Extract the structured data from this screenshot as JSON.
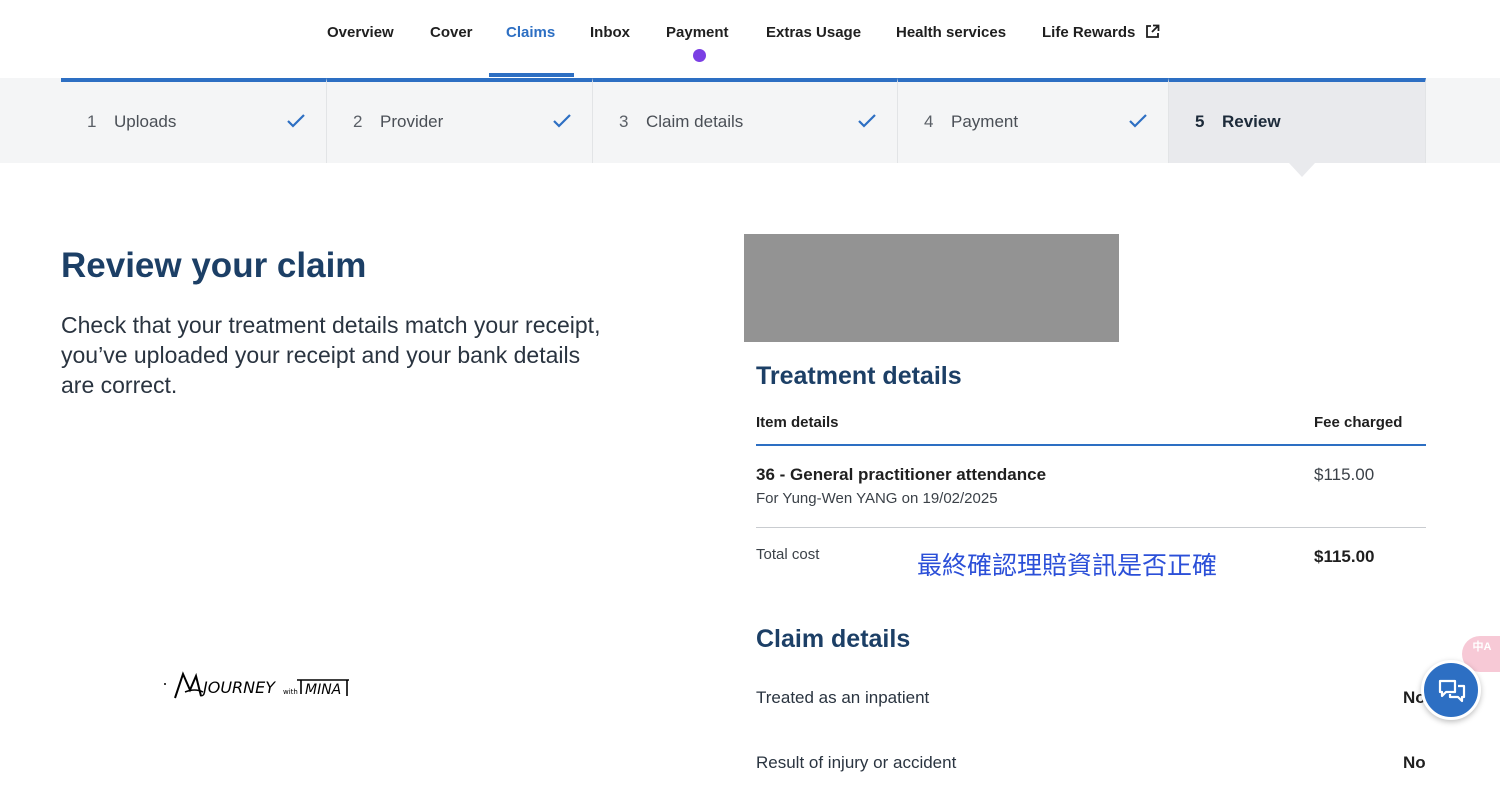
{
  "nav": {
    "items": [
      {
        "label": "Overview"
      },
      {
        "label": "Cover"
      },
      {
        "label": "Claims"
      },
      {
        "label": "Inbox"
      },
      {
        "label": "Payment"
      },
      {
        "label": "Extras Usage"
      },
      {
        "label": "Health services"
      },
      {
        "label": "Life Rewards"
      }
    ],
    "active_item": "Claims",
    "accent_color": "#2d6fc3",
    "notification_dot_color": "#7b3fe4"
  },
  "stepper": {
    "steps": [
      {
        "number": "1",
        "label": "Uploads",
        "status": "complete"
      },
      {
        "number": "2",
        "label": "Provider",
        "status": "complete"
      },
      {
        "number": "3",
        "label": "Claim details",
        "status": "complete"
      },
      {
        "number": "4",
        "label": "Payment",
        "status": "complete"
      },
      {
        "number": "5",
        "label": "Review",
        "status": "current"
      }
    ]
  },
  "intro": {
    "title": "Review your claim",
    "description": "Check that your treatment details match your receipt, you’ve uploaded your receipt and your bank details are correct."
  },
  "treatment": {
    "title": "Treatment details",
    "col_item": "Item details",
    "col_fee": "Fee charged",
    "item_title": "36 - General practitioner attendance",
    "item_sub": "For Yung-Wen YANG on 19/02/2025",
    "item_fee": "$115.00",
    "total_label": "Total cost",
    "total_value": "$115.00",
    "annotation": "最終確認理賠資訊是否正確"
  },
  "claim_details": {
    "title": "Claim details",
    "rows": [
      {
        "label": "Treated as an inpatient",
        "value": "No"
      },
      {
        "label": "Result of injury or accident",
        "value": "No"
      }
    ]
  },
  "translate_tab": {
    "label": "中A"
  },
  "icons": {
    "external_link": "external-link-icon",
    "check": "check-icon",
    "chat": "chat-icon",
    "translate": "translate-icon"
  }
}
